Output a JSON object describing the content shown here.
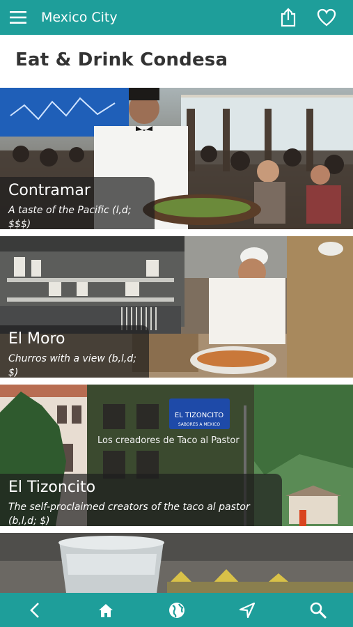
{
  "header": {
    "title": "Mexico City",
    "menu_icon": "hamburger-menu-icon",
    "share_icon": "share-icon",
    "favorite_icon": "heart-icon"
  },
  "page": {
    "title": "Eat & Drink Condesa"
  },
  "listings": [
    {
      "name": "Contramar",
      "description": "A taste of the Pacific (l,d; $$$)"
    },
    {
      "name": "El Moro",
      "description": "Churros with a view (b,l,d; $)"
    },
    {
      "name": "El Tizoncito",
      "description": "The self-proclaimed creators of the taco al pastor (b,l,d; $)",
      "sign_name": "EL TIZONCITO",
      "sign_sub": "SABORES A MEXICO",
      "wall_text": "Los creadores de Taco al Pastor"
    },
    {
      "name": "",
      "description": ""
    }
  ],
  "bottom_nav": {
    "items": [
      "back-icon",
      "home-icon",
      "globe-icon",
      "navigate-icon",
      "search-icon"
    ]
  },
  "colors": {
    "brand": "#1e9e9a",
    "caption_bg": "rgba(30,30,30,0.70)"
  }
}
